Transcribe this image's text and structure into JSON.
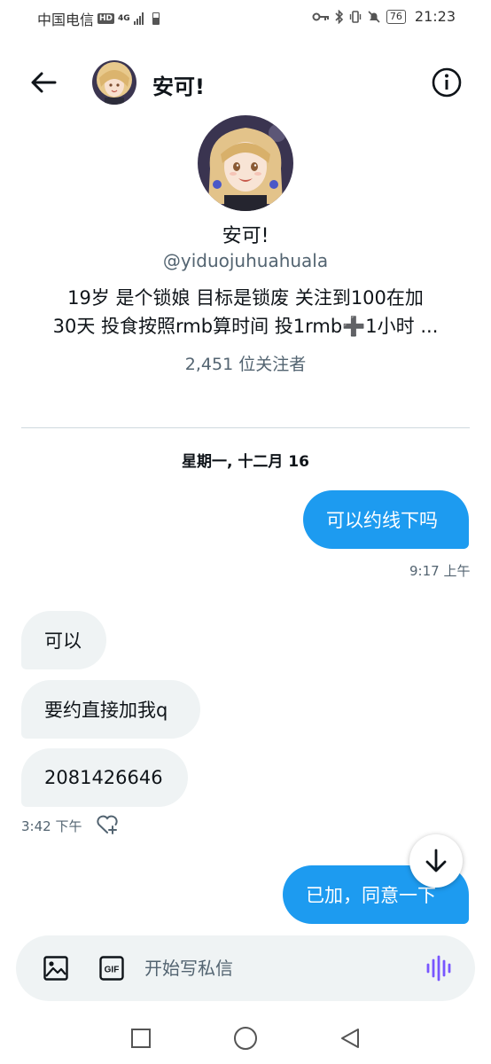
{
  "status_bar": {
    "carrier": "中国电信",
    "hd": "HD",
    "net": "4G",
    "battery": "76",
    "time": "21:23"
  },
  "header": {
    "title": "安可!"
  },
  "profile": {
    "name": "安可!",
    "handle": "@yiduojuhuahuala",
    "bio_line1": "19岁 是个锁娘 目标是锁废 关注到100在加",
    "bio_line2": "30天 投食按照rmb算时间 投1rmb➕1小时 ...",
    "followers": "2,451 位关注者"
  },
  "conversation": {
    "date": "星期一, 十二月 16",
    "messages": [
      {
        "text": "可以约线下吗",
        "direction": "out"
      },
      {
        "text": "可以",
        "direction": "in"
      },
      {
        "text": "要约直接加我q",
        "direction": "in"
      },
      {
        "text": "2081426646",
        "direction": "in"
      },
      {
        "text": "已加，同意一下",
        "direction": "out"
      }
    ],
    "time_out_1": "9:17 上午",
    "time_in_1": "3:42 下午"
  },
  "composer": {
    "placeholder": "开始写私信",
    "gif_label": "GIF"
  },
  "colors": {
    "accent": "#1d9bf0",
    "incoming_bubble": "#eff3f4",
    "secondary_text": "#536471",
    "voice_icon": "#7856ff"
  },
  "icons": [
    "back-arrow-icon",
    "info-icon",
    "image-icon",
    "gif-icon",
    "voice-wave-icon",
    "arrow-down-icon",
    "heart-plus-icon",
    "nav-square-icon",
    "nav-circle-icon",
    "nav-triangle-icon"
  ]
}
